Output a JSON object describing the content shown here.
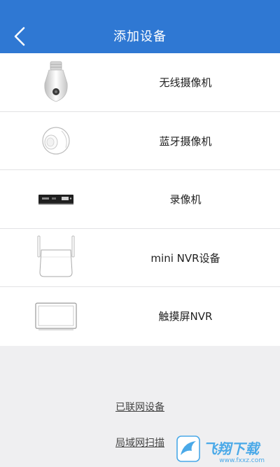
{
  "header": {
    "title": "添加设备",
    "back_icon": "chevron-left-icon",
    "background": "#2f78d3"
  },
  "devices": [
    {
      "label": "无线摄像机",
      "icon": "bulb-camera-icon"
    },
    {
      "label": "蓝牙摄像机",
      "icon": "dome-camera-icon"
    },
    {
      "label": "录像机",
      "icon": "dvr-recorder-icon"
    },
    {
      "label": "mini NVR设备",
      "icon": "mini-nvr-icon"
    },
    {
      "label": "触摸屏NVR",
      "icon": "touchscreen-nvr-icon"
    }
  ],
  "footer": {
    "connected_devices": "已联网设备",
    "lan_scan": "局域网扫描"
  },
  "watermark": {
    "brand": "飞翔下载",
    "domain": "www.fxxz.com"
  }
}
